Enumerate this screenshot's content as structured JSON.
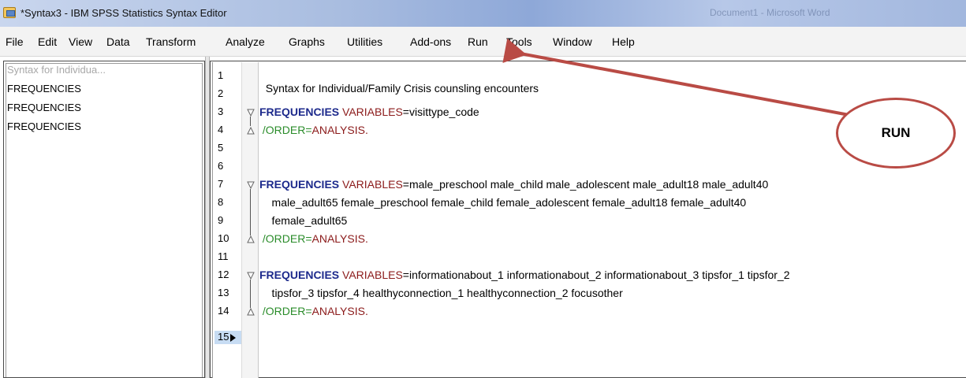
{
  "window": {
    "title": "*Syntax3 - IBM SPSS Statistics Syntax Editor",
    "background_title": "Document1 - Microsoft Word"
  },
  "menu": {
    "items": [
      "File",
      "Edit",
      "View",
      "Data",
      "Transform",
      "Analyze",
      "Graphs",
      "Utilities",
      "Add-ons",
      "Run",
      "Tools",
      "Window",
      "Help"
    ]
  },
  "outline": {
    "items": [
      "Syntax for Individua...",
      "FREQUENCIES",
      "FREQUENCIES",
      "FREQUENCIES"
    ]
  },
  "editor": {
    "line_numbers": [
      "1",
      "2",
      "3",
      "4",
      "5",
      "6",
      "7",
      "8",
      "9",
      "10",
      "11",
      "12",
      "13",
      "14",
      "15"
    ],
    "current_line": "15",
    "lines": {
      "l1": "Syntax for Individual/Family Crisis counsling encounters",
      "l3_kw": "FREQUENCIES",
      "l3_sub": " VARIABLES",
      "l3_rest": "=visittype_code",
      "l4_slash": " /ORDER=",
      "l4_val": "ANALYSIS.",
      "l7_kw": "FREQUENCIES",
      "l7_sub": " VARIABLES",
      "l7_rest": "=male_preschool male_child male_adolescent male_adult18 male_adult40",
      "l8": "    male_adult65 female_preschool female_child female_adolescent female_adult18 female_adult40",
      "l9": "    female_adult65",
      "l10_slash": " /ORDER=",
      "l10_val": "ANALYSIS.",
      "l12_kw": "FREQUENCIES",
      "l12_sub": " VARIABLES",
      "l12_rest": "=informationabout_1 informationabout_2 informationabout_3 tipsfor_1 tipsfor_2",
      "l13": "    tipsfor_3 tipsfor_4 healthyconnection_1 healthyconnection_2 focusother",
      "l14_slash": " /ORDER=",
      "l14_val": "ANALYSIS."
    }
  },
  "annotation": {
    "label": "RUN",
    "color": "#b94b45"
  }
}
